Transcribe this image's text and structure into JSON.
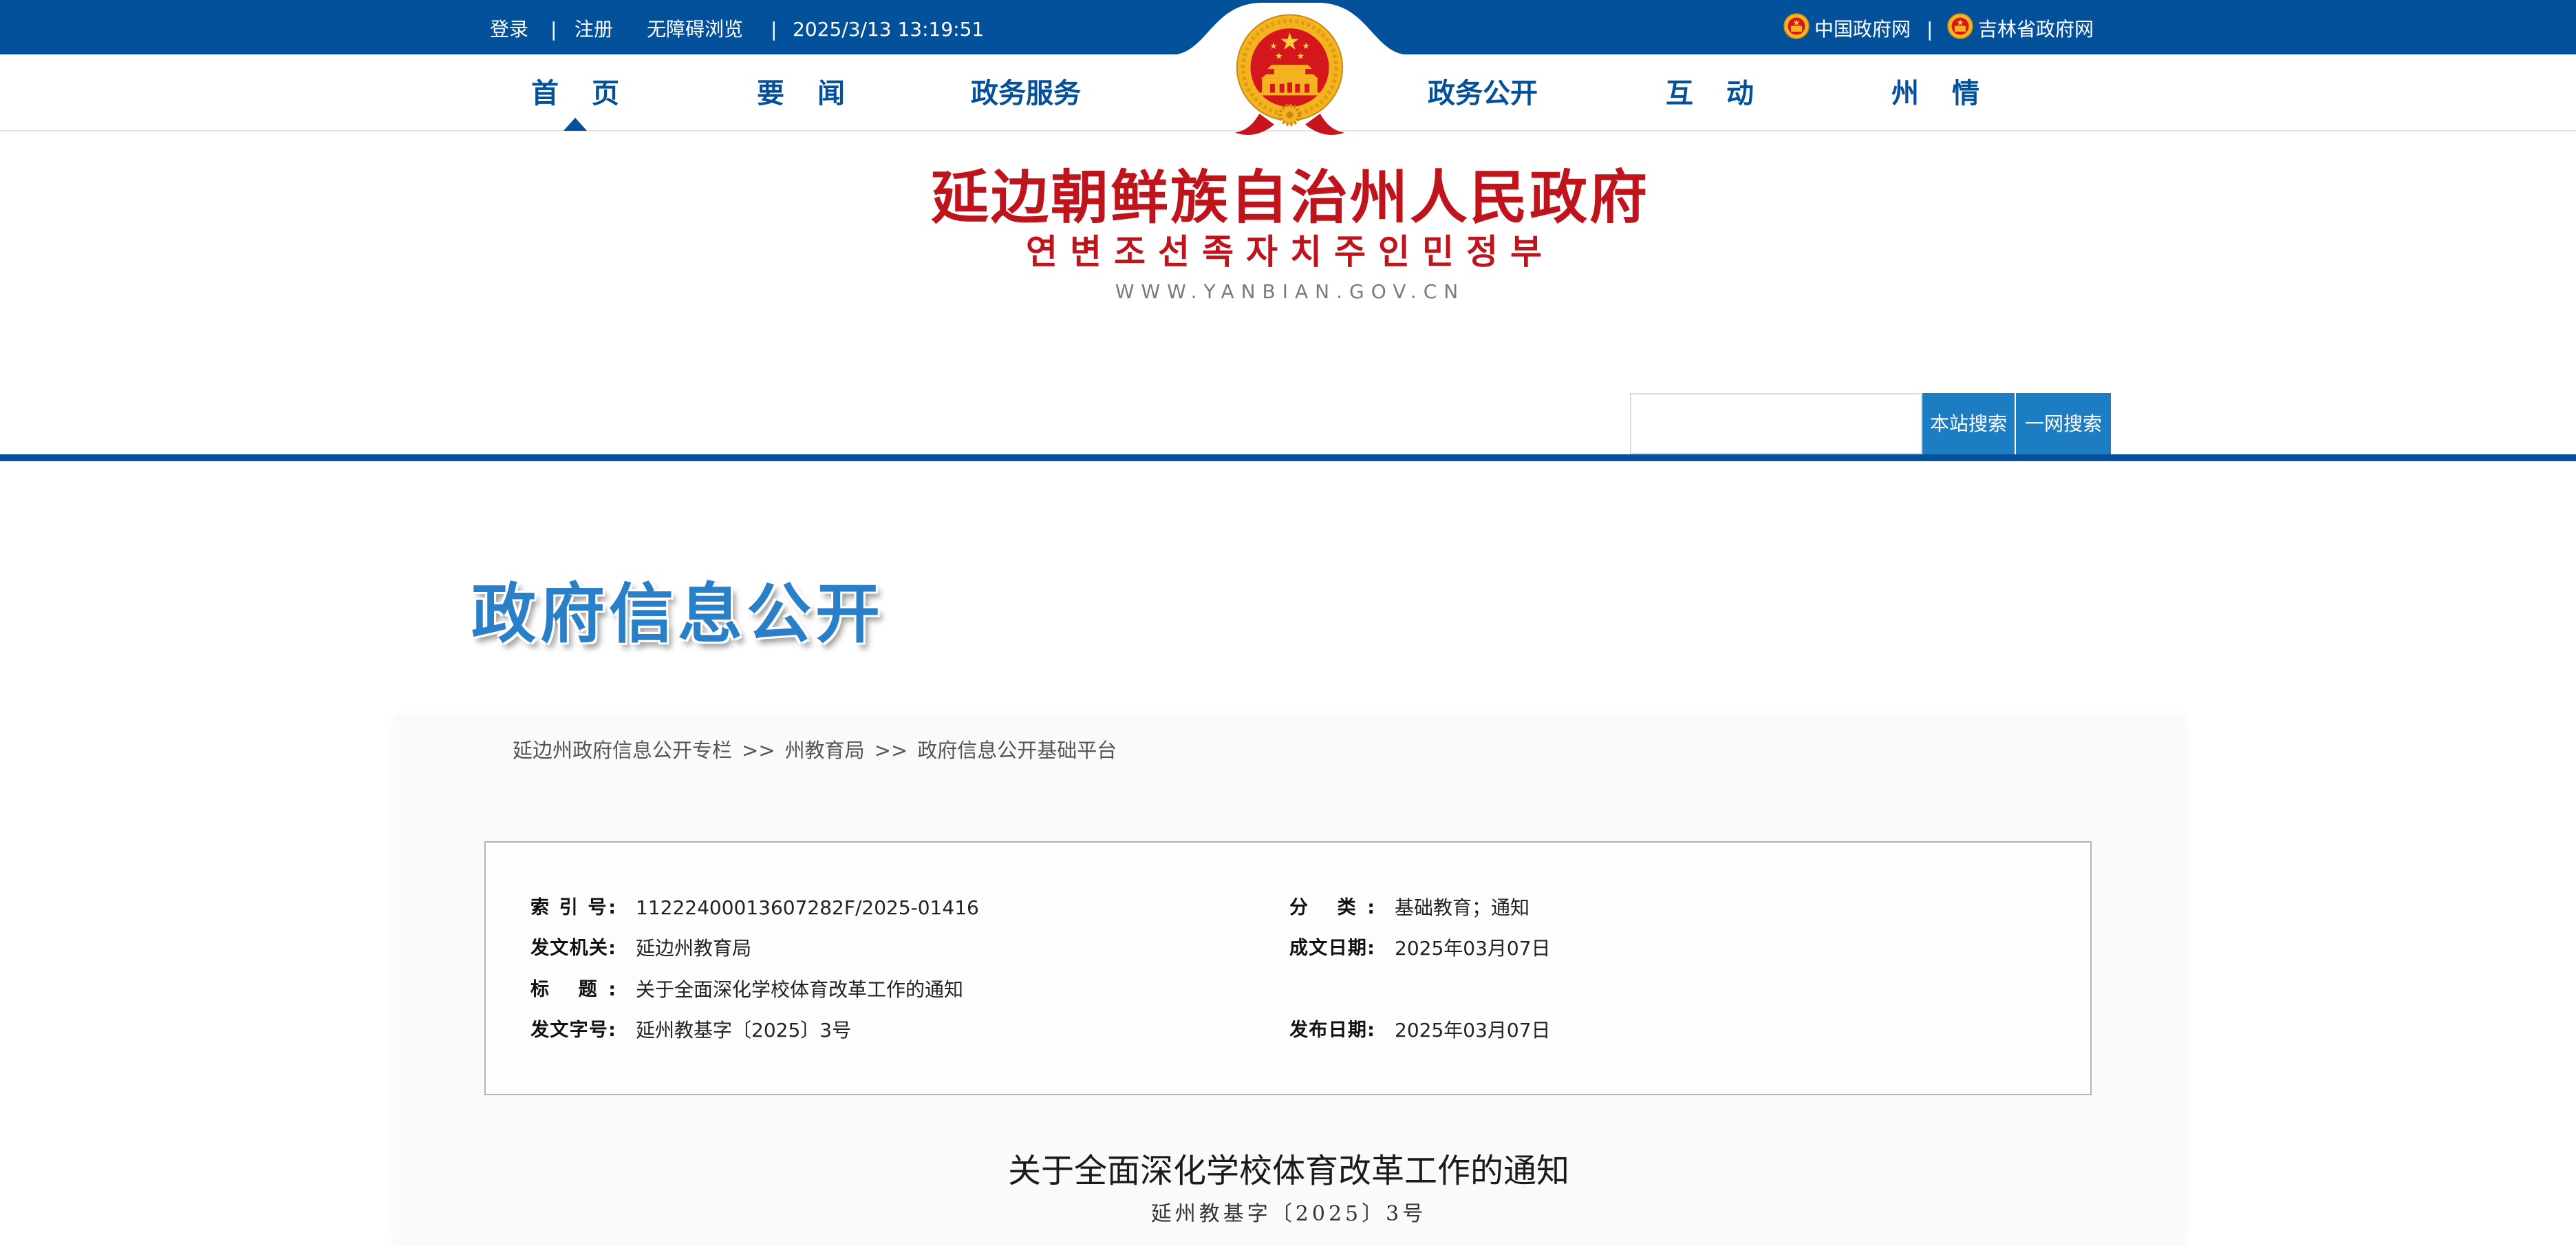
{
  "topbar": {
    "login": "登录",
    "separator": "|",
    "register": "注册",
    "accessibility": "无障碍浏览",
    "datetime": "2025/3/13 13:19:51",
    "links": [
      {
        "label": "中国政府网",
        "icon": "national-emblem-icon"
      },
      {
        "label": "吉林省政府网",
        "icon": "national-emblem-icon"
      }
    ]
  },
  "nav": {
    "emblem": "national-emblem-icon",
    "items": [
      {
        "label": "首 页",
        "active": true
      },
      {
        "label": "要 闻"
      },
      {
        "label": "政务服务"
      },
      {
        "label": "政务公开"
      },
      {
        "label": "互 动"
      },
      {
        "label": "州 情"
      }
    ]
  },
  "header": {
    "title_cn": "延边朝鲜族自治州人民政府",
    "title_kr": "연변조선족자치주인민정부",
    "domain": "WWW.YANBIAN.GOV.CN"
  },
  "search": {
    "value": "",
    "placeholder": "",
    "site_button": "本站搜索",
    "web_button": "一网搜索"
  },
  "section": {
    "heading": "政府信息公开"
  },
  "breadcrumb": {
    "separator": ">>",
    "items": [
      "延边州政府信息公开专栏",
      "州教育局",
      "政府信息公开基础平台"
    ]
  },
  "info": {
    "index_no": {
      "label": "索 引 号:",
      "value": "11222400013607282F/2025-01416"
    },
    "category": {
      "label": "分 类:",
      "value": "基础教育；通知"
    },
    "issuer": {
      "label": "发文机关:",
      "value": "延边州教育局"
    },
    "written_date": {
      "label": "成文日期:",
      "value": "2025年03月07日"
    },
    "title": {
      "label": "标 题:",
      "value": "关于全面深化学校体育改革工作的通知"
    },
    "doc_no": {
      "label": "发文字号:",
      "value": "延州教基字〔2025〕3号"
    },
    "publish_date": {
      "label": "发布日期:",
      "value": "2025年03月07日"
    }
  },
  "article": {
    "title": "关于全面深化学校体育改革工作的通知",
    "doc_no": "延州教基字〔2025〕3号"
  },
  "colors": {
    "primary": "#04519b",
    "search_button": "#1d7dc3",
    "logo_red": "#c0141c",
    "heading_blue": "#2a80c8"
  }
}
